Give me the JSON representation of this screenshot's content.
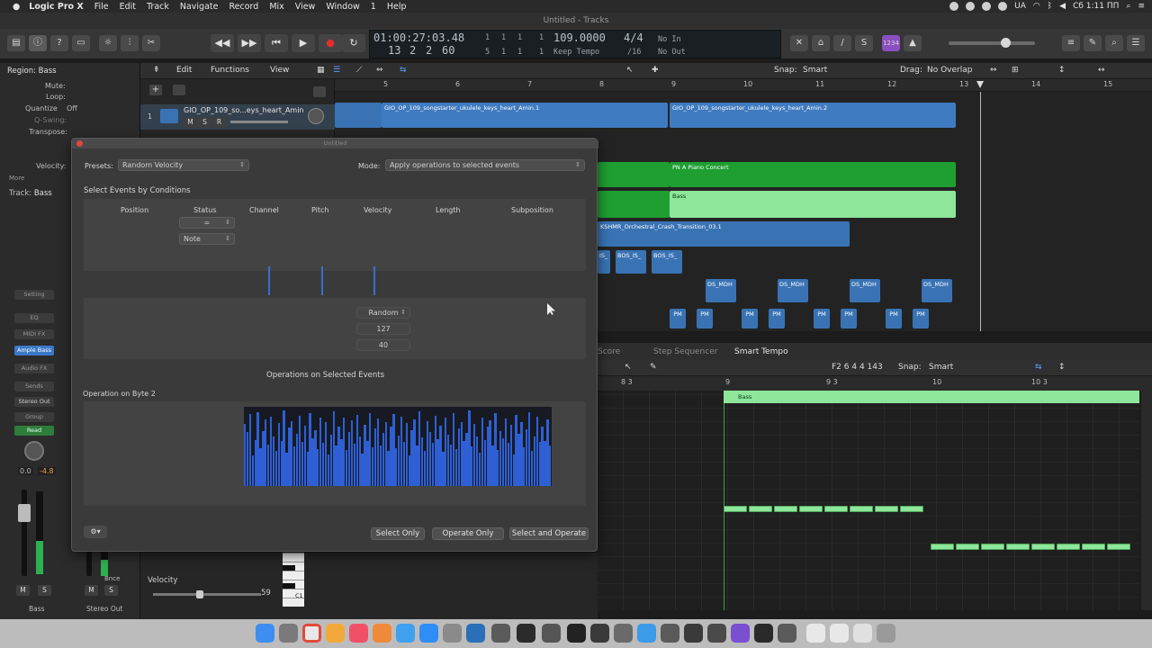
{
  "menubar": {
    "app": "Logic Pro X",
    "items": [
      "File",
      "Edit",
      "Track",
      "Navigate",
      "Record",
      "Mix",
      "View",
      "Window",
      "1",
      "Help"
    ],
    "status": {
      "lang": "UA",
      "clock": "Сб 1:11 ПП"
    }
  },
  "window": {
    "title": "Untitled - Tracks"
  },
  "lcd": {
    "smpte": "01:00:27:03.48",
    "pos_top": [
      "1",
      "1",
      "1",
      "1"
    ],
    "bar": "13",
    "beat": "2",
    "div": "2",
    "tick": "60",
    "pos_bottom": [
      "5",
      "1",
      "1",
      "1"
    ],
    "tempo": "109.0000",
    "tempo_mode": "Keep Tempo",
    "sig_top": "4/4",
    "sig_bottom": "/16",
    "in": "No In",
    "out": "No Out"
  },
  "toolbar": {
    "cycle_label": "1234"
  },
  "inspector": {
    "region": "Region: Bass",
    "mute": "Mute:",
    "loop": "Loop:",
    "quantize": "Quantize",
    "quantize_val": "Off",
    "qswing": "Q-Swing:",
    "transpose": "Transpose:",
    "velocity": "Velocity:",
    "more": "More",
    "track": "Track:",
    "track_name": "Bass",
    "setting": "Setting",
    "eq": "EQ",
    "midi_fx": "MIDI FX",
    "instrument": "Ample Bass",
    "audio_fx": "Audio FX",
    "sends": "Sends",
    "output": "Stereo Out",
    "group": "Group",
    "automation": "Read",
    "vol_a": "0.0",
    "vol_b": "-4.8",
    "bnce": "Bnce",
    "name_a": "Bass",
    "name_b": "Stereo Out",
    "m": "M",
    "s": "S"
  },
  "arrange": {
    "menus": [
      "Edit",
      "Functions",
      "View"
    ],
    "snap_label": "Snap:",
    "snap": "Smart",
    "drag_label": "Drag:",
    "drag": "No Overlap",
    "bars": [
      "5",
      "6",
      "7",
      "8",
      "9",
      "10",
      "11",
      "12",
      "13",
      "14",
      "15"
    ],
    "track1": {
      "num": "1",
      "name": "GIO_OP_109_so...eys_heart_Amin",
      "m": "M",
      "s": "S",
      "r": "R"
    },
    "regions": {
      "audio1": "GIO_OP_109_songstarter_ukulele_keys_heart_Amin.1",
      "audio2": "GIO_OP_109_songstarter_ukulele_keys_heart_Amin.2",
      "piano": "PN A Piano Concert",
      "bass": "Bass",
      "crash": "KSHMR_Orchestral_Crash_Transition_03.1",
      "bos1": "IS_",
      "bos2": "BOS_IS_",
      "bos3": "BOS_IS_",
      "ds": "DS_MDH",
      "pm": "PM"
    }
  },
  "editor": {
    "tabs": [
      "Score",
      "Step Sequencer",
      "Smart Tempo"
    ],
    "position": "F2  6 4 4 143",
    "snap_label": "Snap:",
    "snap": "Smart",
    "ruler": [
      "8 3",
      "9",
      "9 3",
      "10",
      "10 3"
    ],
    "region_name": "Bass",
    "velocity_label": "Velocity",
    "velocity": "59",
    "key_c1": "C1"
  },
  "dialog": {
    "title": "Untitled",
    "presets_label": "Presets:",
    "preset": "Random Velocity",
    "mode_label": "Mode:",
    "mode": "Apply operations to selected events",
    "select_heading": "Select Events by Conditions",
    "columns": [
      "Position",
      "Status",
      "Channel",
      "Pitch",
      "Velocity",
      "Length",
      "Subposition"
    ],
    "status_cond": "=",
    "status_val": "Note",
    "op_mode": "Random",
    "op_val1": "127",
    "op_val2": "40",
    "ops_heading": "Operations on Selected Events",
    "byte2": "Operation on Byte 2",
    "btn_select": "Select Only",
    "btn_operate": "Operate Only",
    "btn_both": "Select and Operate"
  },
  "chart_data": {
    "type": "bar",
    "title": "",
    "values": [
      82,
      71,
      95,
      40,
      61,
      98,
      50,
      73,
      88,
      55,
      92,
      66,
      47,
      83,
      59,
      100,
      44,
      77,
      86,
      52,
      69,
      93,
      58,
      80,
      45,
      96,
      63,
      74,
      49,
      90,
      57,
      85,
      42,
      68,
      99,
      53,
      79,
      62,
      91,
      48,
      72,
      87,
      56,
      94,
      65,
      43,
      81,
      60,
      97,
      51,
      76,
      89,
      54,
      70,
      84,
      46,
      78,
      95,
      50,
      67,
      92,
      58,
      83,
      41,
      74,
      88,
      53,
      99,
      64,
      47,
      86,
      71,
      57,
      93,
      62,
      80,
      45,
      90,
      68,
      55,
      97,
      49,
      76,
      84,
      59,
      70,
      100,
      52,
      82,
      66,
      44,
      91,
      61,
      78,
      87,
      54,
      96,
      48,
      73,
      63,
      89,
      57,
      81,
      42,
      94,
      69,
      85,
      51,
      75,
      98,
      46,
      65,
      92,
      58,
      79,
      60,
      88,
      53
    ],
    "ylim": [
      0,
      100
    ]
  }
}
